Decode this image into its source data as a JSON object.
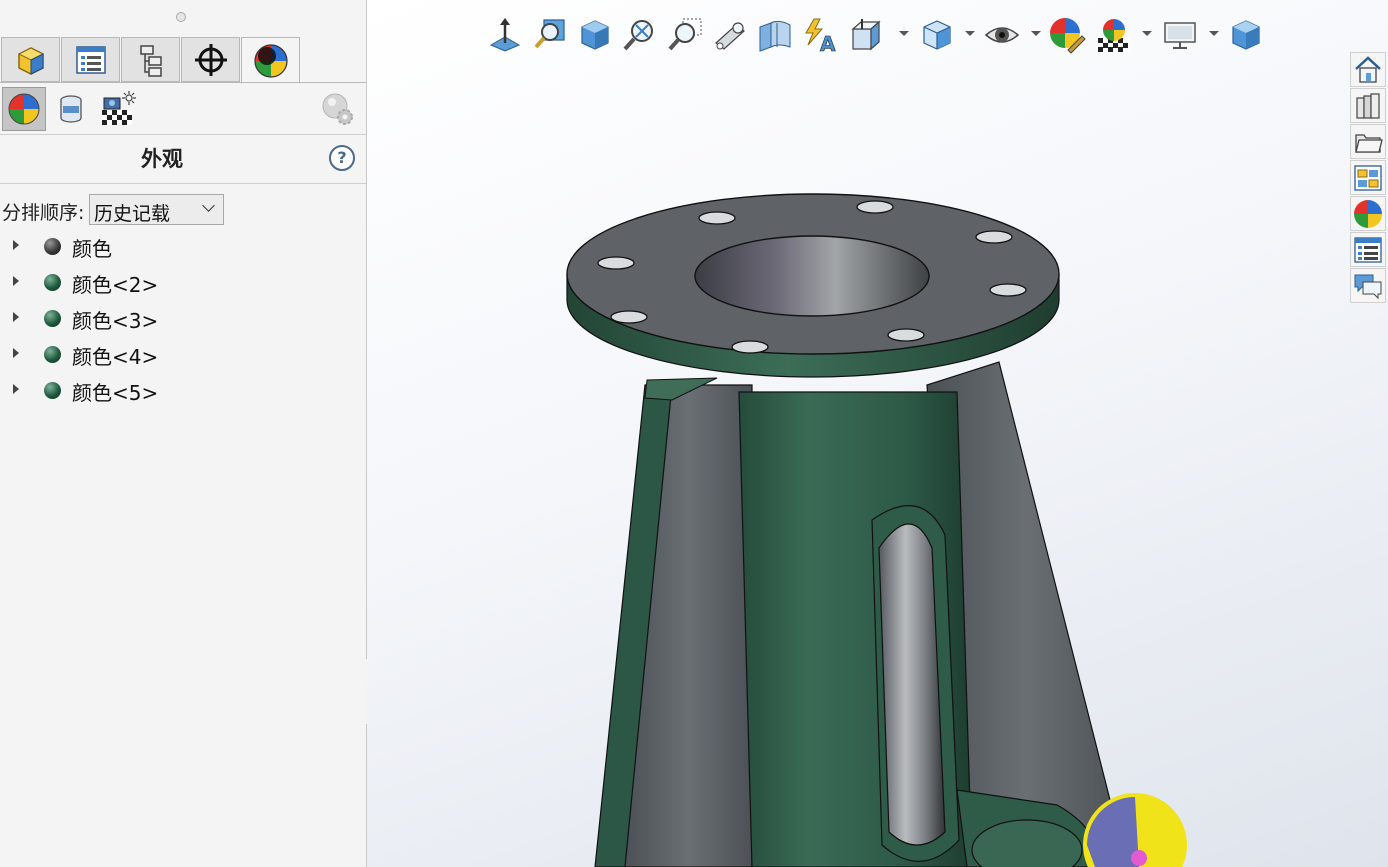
{
  "left_panel": {
    "tabs": [
      {
        "icon": "part-icon"
      },
      {
        "icon": "property-manager-icon"
      },
      {
        "icon": "configuration-manager-icon"
      },
      {
        "icon": "dimxpert-icon"
      },
      {
        "icon": "display-manager-icon"
      }
    ],
    "sub_tabs": [
      {
        "icon": "appearances-icon"
      },
      {
        "icon": "decals-icon"
      },
      {
        "icon": "scene-lights-cameras-icon"
      },
      {
        "icon": "render-settings-icon"
      }
    ],
    "title": "外观",
    "help_label": "?",
    "sort_label": "分排顺序:",
    "sort_value": "历史记载",
    "tree_items": [
      {
        "label": "颜色",
        "color": "#3a3a3a"
      },
      {
        "label": "颜色<2>",
        "color": "#1e5a3e"
      },
      {
        "label": "颜色<3>",
        "color": "#1e5a3e"
      },
      {
        "label": "颜色<4>",
        "color": "#1e5a3e"
      },
      {
        "label": "颜色<5>",
        "color": "#1e5a3e"
      }
    ]
  },
  "heads_up_toolbar": [
    {
      "name": "view-normal-icon"
    },
    {
      "name": "zoom-to-fit-icon"
    },
    {
      "name": "view-orientation-cube-icon"
    },
    {
      "name": "zoom-in-out-icon"
    },
    {
      "name": "zoom-to-area-icon"
    },
    {
      "name": "previous-view-icon"
    },
    {
      "name": "section-view-icon"
    },
    {
      "name": "dynamic-annotation-icon"
    },
    {
      "name": "view-orientation-icon",
      "dropdown": true
    },
    {
      "name": "display-style-icon",
      "dropdown": true
    },
    {
      "name": "hide-show-items-icon",
      "dropdown": true
    },
    {
      "name": "edit-appearance-icon"
    },
    {
      "name": "apply-scene-icon",
      "dropdown": true
    },
    {
      "name": "view-settings-icon",
      "dropdown": true
    },
    {
      "name": "3d-view-cube-icon"
    }
  ],
  "task_pane": [
    {
      "name": "solidworks-resources-icon"
    },
    {
      "name": "design-library-icon"
    },
    {
      "name": "file-explorer-icon"
    },
    {
      "name": "view-palette-icon"
    },
    {
      "name": "appearances-scenes-icon"
    },
    {
      "name": "custom-properties-icon"
    },
    {
      "name": "forum-icon"
    }
  ],
  "colors": {
    "model_green": "#2e5a48",
    "model_gray": "#5d6166",
    "panel_bg": "#f4f4f4"
  }
}
